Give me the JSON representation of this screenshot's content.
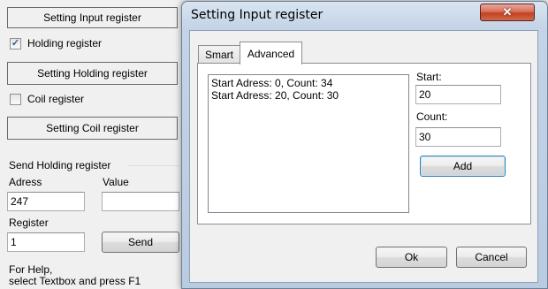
{
  "main": {
    "setting_input_btn": "Setting Input register",
    "holding_checkbox_label": "Holding register",
    "holding_checked": true,
    "setting_holding_btn": "Setting Holding register",
    "coil_checkbox_label": "Coil register",
    "coil_checked": false,
    "setting_coil_btn": "Setting Coil register",
    "send_group_label": "Send Holding register",
    "adress_label": "Adress",
    "value_label": "Value",
    "adress_value": "247",
    "value_value": "",
    "register_label": "Register",
    "register_value": "1",
    "send_btn": "Send",
    "help_line1": "For Help,",
    "help_line2": "select Textbox and press F1"
  },
  "dialog": {
    "title": "Setting Input register",
    "close_glyph": "✕",
    "tabs": [
      {
        "label": "Smart",
        "active": false
      },
      {
        "label": "Advanced",
        "active": true
      }
    ],
    "list_items": [
      "Start Adress: 0, Count: 34",
      "Start Adress: 20, Count: 30"
    ],
    "start_label": "Start:",
    "start_value": "20",
    "count_label": "Count:",
    "count_value": "30",
    "add_btn": "Add",
    "ok_btn": "Ok",
    "cancel_btn": "Cancel"
  },
  "colors": {
    "title_bar": "#c4d4e6",
    "close_button": "#c2411f",
    "window_bg": "#f0f0f0"
  }
}
